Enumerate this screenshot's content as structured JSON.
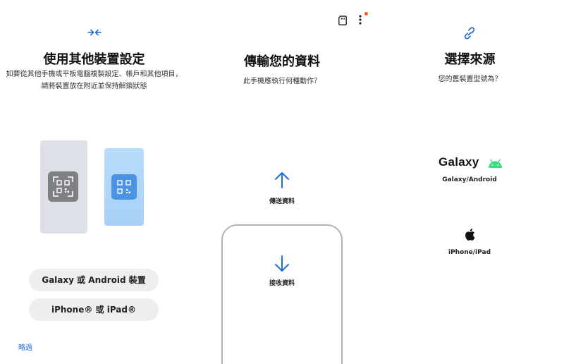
{
  "toolbar": {
    "sd_icon": "sd-card-icon",
    "more_icon": "more-vert-icon",
    "notification_color": "#ef5a2b"
  },
  "left": {
    "icon": "transfer-arrows-icon",
    "title": "使用其他裝置設定",
    "subtitle_line1": "如要從其他手機或平板電腦複製設定、帳戶和其他項目，",
    "subtitle_line2": "請將裝置放在附近並保持解鎖狀態",
    "buttons": {
      "galaxy": "Galaxy 或 Android 裝置",
      "iphone": "iPhone® 或 iPad®"
    },
    "skip": "略過"
  },
  "middle": {
    "title": "傳輸您的資料",
    "subtitle": "此手機應執行何種動作？",
    "send_label": "傳送資料",
    "receive_label": "接收資料"
  },
  "right": {
    "icon": "link-icon",
    "title": "選擇來源",
    "subtitle": "您的舊裝置型號為？",
    "galaxy_wordmark": "Galaxy",
    "galaxy_label": "Galaxy/Android",
    "iphone_label": "iPhone/iPad"
  },
  "colors": {
    "accent_blue": "#1f6ed4",
    "android_green": "#3ddc84",
    "qr_gray": "#7f8083",
    "qr_blue": "#4b94e3"
  }
}
